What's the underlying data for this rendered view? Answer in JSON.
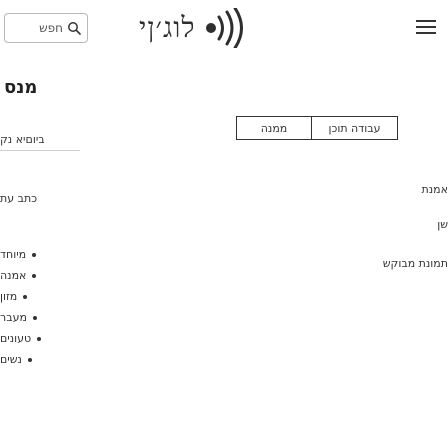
{
  "header": {
    "search": {
      "label": "חפש"
    },
    "logo": {
      "text": "לוג׳ןי"
    },
    "menu_icon": "hamburger-icon"
  },
  "sidebar": {
    "title": "מנס",
    "sub_link": "ביוםיא נק",
    "category_heading": "כתב עת",
    "items": [
      "מיוחד",
      "אמנה",
      "מזון",
      "מעבר",
      "טעונים",
      "נשים"
    ]
  },
  "tabs": {
    "left": "ממנה",
    "right": "עבודה תוכן"
  },
  "main": {
    "line_1": "אמנת",
    "line_2": "שן",
    "line_3": "תמונת מבוקש"
  }
}
